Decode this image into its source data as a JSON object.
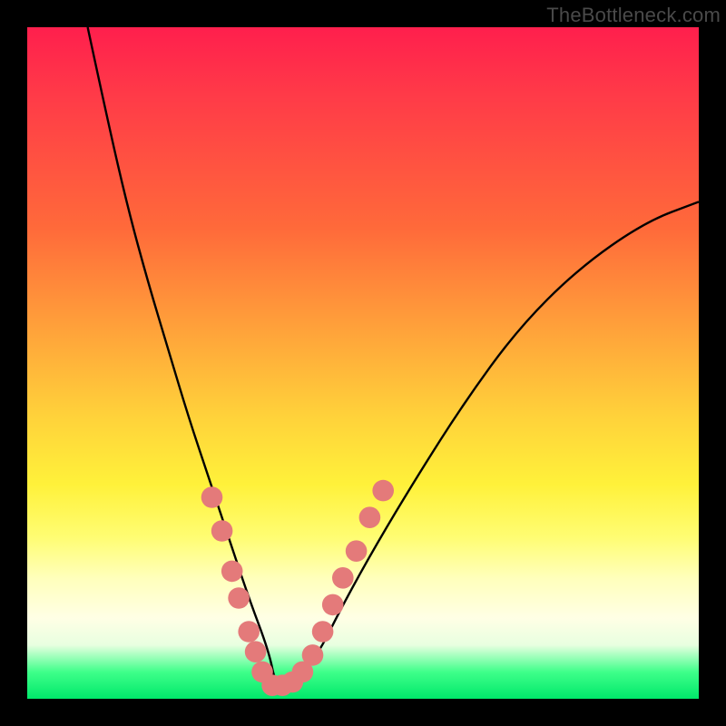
{
  "watermark": "TheBottleneck.com",
  "chart_data": {
    "type": "line",
    "title": "",
    "xlabel": "",
    "ylabel": "",
    "xlim": [
      0,
      100
    ],
    "ylim": [
      0,
      100
    ],
    "series": [
      {
        "name": "bottleneck-curve",
        "x": [
          9,
          12,
          15,
          18,
          21,
          24,
          27,
          30,
          33,
          36,
          37,
          39,
          43,
          47,
          52,
          58,
          65,
          73,
          82,
          92,
          100
        ],
        "y": [
          100,
          86,
          73,
          62,
          52,
          42,
          33,
          24,
          15,
          7,
          2,
          2,
          6,
          14,
          23,
          33,
          44,
          55,
          64,
          71,
          74
        ],
        "stroke": "#000000"
      }
    ],
    "markers": {
      "name": "highlighted-range-dots",
      "color": "#e47a7a",
      "radius_pct": 1.6,
      "points": [
        {
          "x": 27.5,
          "y": 30
        },
        {
          "x": 29.0,
          "y": 25
        },
        {
          "x": 30.5,
          "y": 19
        },
        {
          "x": 31.5,
          "y": 15
        },
        {
          "x": 33.0,
          "y": 10
        },
        {
          "x": 34.0,
          "y": 7
        },
        {
          "x": 35.0,
          "y": 4
        },
        {
          "x": 36.5,
          "y": 2
        },
        {
          "x": 38.0,
          "y": 2
        },
        {
          "x": 39.5,
          "y": 2.5
        },
        {
          "x": 41.0,
          "y": 4
        },
        {
          "x": 42.5,
          "y": 6.5
        },
        {
          "x": 44.0,
          "y": 10
        },
        {
          "x": 45.5,
          "y": 14
        },
        {
          "x": 47.0,
          "y": 18
        },
        {
          "x": 49.0,
          "y": 22
        },
        {
          "x": 51.0,
          "y": 27
        },
        {
          "x": 53.0,
          "y": 31
        }
      ]
    },
    "gradient_stops": [
      {
        "pct": 0,
        "color": "#ff1f4d"
      },
      {
        "pct": 50,
        "color": "#ffd23a"
      },
      {
        "pct": 85,
        "color": "#ffffe0"
      },
      {
        "pct": 100,
        "color": "#00e86a"
      }
    ]
  }
}
